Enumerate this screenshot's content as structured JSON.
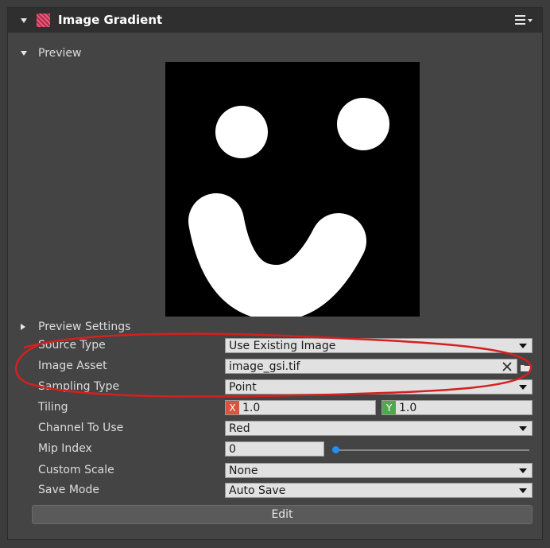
{
  "header": {
    "title": "Image Gradient",
    "icon": "image-gradient-icon",
    "menu_icon": "hamburger-menu-icon"
  },
  "preview": {
    "section_label": "Preview",
    "image": "smiley-preview-image"
  },
  "preview_settings": {
    "label": "Preview Settings"
  },
  "properties": {
    "source_type": {
      "label": "Source Type",
      "value": "Use Existing Image"
    },
    "image_asset": {
      "label": "Image Asset",
      "value": "image_gsi.tif"
    },
    "sampling_type": {
      "label": "Sampling Type",
      "value": "Point"
    },
    "tiling": {
      "label": "Tiling",
      "x_axis": "X",
      "x_value": "1.0",
      "y_axis": "Y",
      "y_value": "1.0"
    },
    "channel_to_use": {
      "label": "Channel To Use",
      "value": "Red"
    },
    "mip_index": {
      "label": "Mip Index",
      "value": "0",
      "slider_fraction": 0
    },
    "custom_scale": {
      "label": "Custom Scale",
      "value": "None"
    },
    "save_mode": {
      "label": "Save Mode",
      "value": "Auto Save"
    }
  },
  "edit_button": {
    "label": "Edit"
  },
  "colors": {
    "annotation": "#d42020",
    "axis_x": "#d9543f",
    "axis_y": "#4ea84e",
    "slider_thumb": "#1e90ff"
  }
}
